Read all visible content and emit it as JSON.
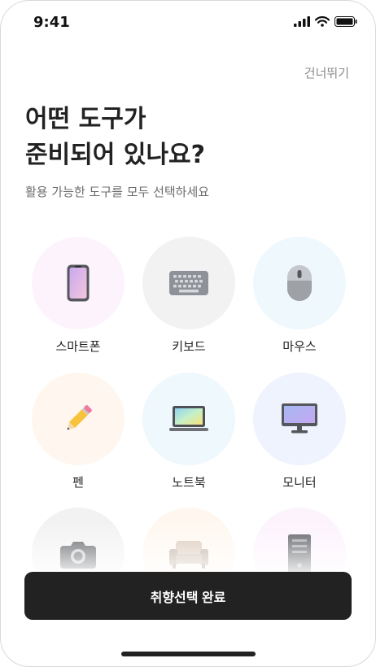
{
  "status_bar": {
    "time": "9:41"
  },
  "header": {
    "skip_label": "건너뛰기"
  },
  "main": {
    "title_line1": "어떤 도구가",
    "title_line2": "준비되어 있나요?",
    "subtitle": "활용 가능한 도구를 모두 선택하세요"
  },
  "tools": [
    {
      "label": "스마트폰",
      "icon": "smartphone-icon",
      "bg": "#fdf3fd"
    },
    {
      "label": "키보드",
      "icon": "keyboard-icon",
      "bg": "#f2f2f2"
    },
    {
      "label": "마우스",
      "icon": "mouse-icon",
      "bg": "#eef8fd"
    },
    {
      "label": "펜",
      "icon": "pencil-icon",
      "bg": "#fff7ef"
    },
    {
      "label": "노트북",
      "icon": "laptop-icon",
      "bg": "#eef8fd"
    },
    {
      "label": "모니터",
      "icon": "monitor-icon",
      "bg": "#eef3fd"
    },
    {
      "label": "",
      "icon": "camera-icon",
      "bg": "#f2f2f2"
    },
    {
      "label": "",
      "icon": "sofa-icon",
      "bg": "#fff7ef"
    },
    {
      "label": "",
      "icon": "server-tower-icon",
      "bg": "#fdf3fd"
    }
  ],
  "footer": {
    "confirm_label": "취향선택 완료"
  }
}
